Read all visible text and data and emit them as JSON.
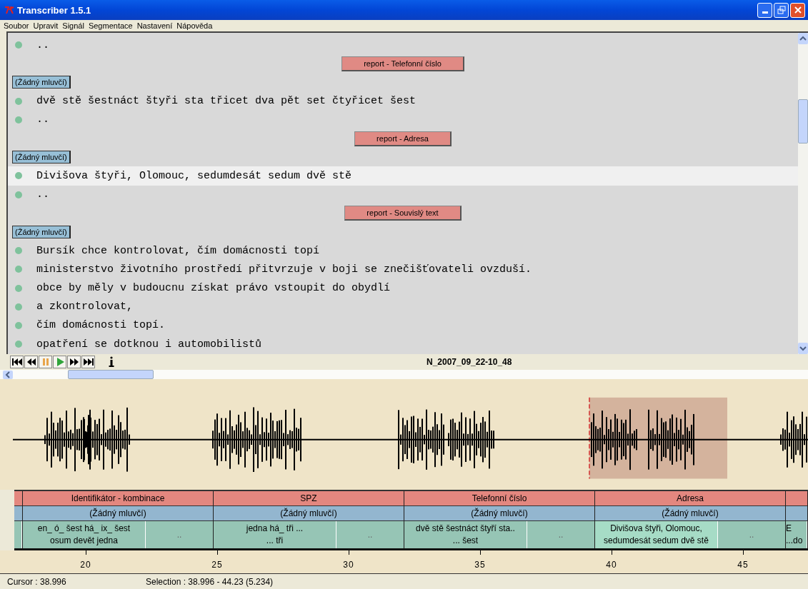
{
  "window": {
    "title": "Transcriber 1.5.1"
  },
  "menu": [
    {
      "label": "Soubor"
    },
    {
      "label": "Upravit"
    },
    {
      "label": "Signál"
    },
    {
      "label": "Segmentace"
    },
    {
      "label": "Nastavení"
    },
    {
      "label": "Nápověda"
    }
  ],
  "transcript": {
    "rows": [
      {
        "kind": "line",
        "text": "..",
        "selected": false
      },
      {
        "kind": "section",
        "text": "report - Telefonní číslo"
      },
      {
        "kind": "speaker",
        "text": "(Žádný mluvčí)"
      },
      {
        "kind": "line",
        "text": "dvě stě šestnáct štyři sta třicet dva pět set čtyřicet šest",
        "selected": false
      },
      {
        "kind": "line",
        "text": "..",
        "selected": false
      },
      {
        "kind": "section",
        "text": "report - Adresa"
      },
      {
        "kind": "speaker",
        "text": "(Žádný mluvčí)"
      },
      {
        "kind": "line",
        "text": "Divišova štyři, Olomouc, sedumdesát sedum dvě stě",
        "selected": true
      },
      {
        "kind": "line",
        "text": "..",
        "selected": false
      },
      {
        "kind": "section",
        "text": "report - Souvislý text"
      },
      {
        "kind": "speaker",
        "text": "(Žádný mluvčí)"
      },
      {
        "kind": "line",
        "text": "Bursík chce kontrolovat, čím domácnosti topí",
        "selected": false
      },
      {
        "kind": "line",
        "text": "ministerstvo životního prostředí přitvrzuje v boji se znečišťovateli ovzduší.",
        "selected": false
      },
      {
        "kind": "line",
        "text": "obce by měly v budoucnu získat právo vstoupit do obydlí",
        "selected": false
      },
      {
        "kind": "line",
        "text": "a zkontrolovat,",
        "selected": false
      },
      {
        "kind": "line",
        "text": "čím domácnosti topí.",
        "selected": false
      },
      {
        "kind": "line",
        "text": "opatření se dotknou i automobilistů",
        "selected": false
      }
    ]
  },
  "player": {
    "file": "N_2007_09_22-10_48"
  },
  "tiers": {
    "topics": [
      {
        "kind": "partial"
      },
      {
        "kind": "full",
        "title": "Identifikátor - kombinace",
        "speaker": "(Žádný mluvčí)",
        "segments": [
          {
            "lines": [
              "en_ ó_ šest há_ ix_ šest",
              "osum devět jedna"
            ],
            "selected": false
          },
          {
            "lines": [
              ".."
            ],
            "selected": false
          }
        ]
      },
      {
        "kind": "full",
        "title": "SPZ",
        "speaker": "(Žádný mluvčí)",
        "segments": [
          {
            "lines": [
              "jedna há_ tři ...",
              "... tři"
            ],
            "selected": false
          },
          {
            "lines": [
              ".."
            ],
            "selected": false
          }
        ]
      },
      {
        "kind": "full",
        "title": "Telefonní číslo",
        "speaker": "(Žádný mluvčí)",
        "segments": [
          {
            "lines": [
              "dvě stě šestnáct štyří sta..",
              "... šest"
            ],
            "selected": false
          },
          {
            "lines": [
              ".."
            ],
            "selected": false
          }
        ]
      },
      {
        "kind": "full",
        "title": "Adresa",
        "speaker": "(Žádný mluvčí)",
        "segments": [
          {
            "lines": [
              "Divišova štyři, Olomouc,",
              "sedumdesát sedum dvě stě"
            ],
            "selected": true
          },
          {
            "lines": [
              ".."
            ],
            "selected": false
          }
        ]
      },
      {
        "kind": "partial",
        "segments": [
          {
            "lines": [
              "E",
              "...do"
            ],
            "selected": false
          }
        ]
      }
    ]
  },
  "axis": {
    "ticks": [
      "20",
      "25",
      "30",
      "35",
      "40",
      "45"
    ]
  },
  "status": {
    "cursor": "Cursor : 38.996",
    "selection": "Selection : 38.996 - 44.23 (5.234)"
  }
}
